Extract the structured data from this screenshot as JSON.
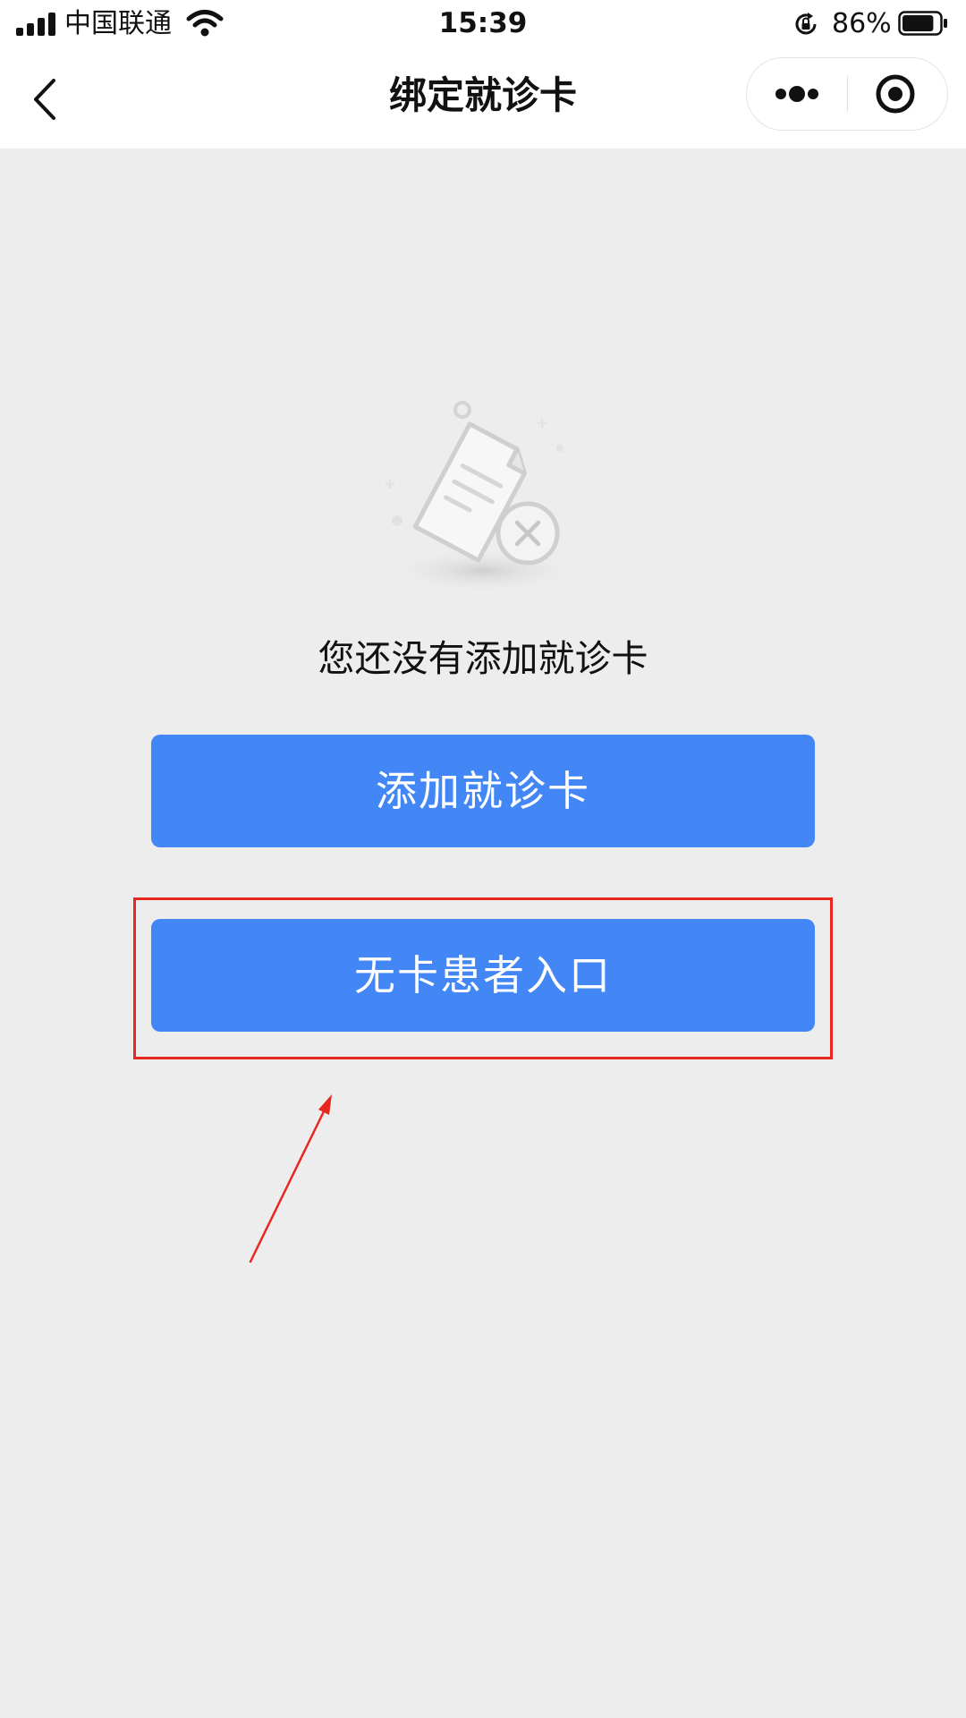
{
  "status_bar": {
    "carrier": "中国联通",
    "time": "15:39",
    "battery_percent": "86%",
    "battery_level": 0.86,
    "icons": [
      "signal-icon",
      "wifi-icon",
      "rotation-lock-icon",
      "battery-icon"
    ]
  },
  "nav_bar": {
    "title": "绑定就诊卡",
    "icons": [
      "back-arrow-icon",
      "more-dots-icon",
      "target-close-icon"
    ]
  },
  "empty_state": {
    "illustration": "empty-card-document-icon",
    "message": "您还没有添加就诊卡"
  },
  "actions": {
    "add_card_label": "添加就诊卡",
    "no_card_label": "无卡患者入口"
  },
  "colors": {
    "background": "#ededed",
    "header": "#ffffff",
    "button": "#4287f5",
    "annotation": "#e8281f"
  }
}
